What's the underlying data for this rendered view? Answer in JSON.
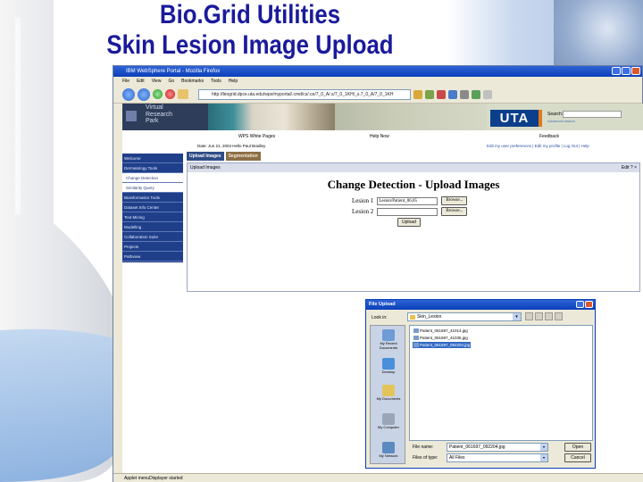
{
  "slide": {
    "title_line1": "Bio.Grid Utilities",
    "title_line2": "Skin Lesion Image Upload"
  },
  "browser": {
    "window_title": "IBM WebSphere Portal - Mozilla Firefox",
    "menu": [
      "File",
      "Edit",
      "View",
      "Go",
      "Bookmarks",
      "Tools",
      "Help"
    ],
    "address": "http://biogrid.dpce.uta.edu/wps/myportal/.cmd/cs/.ce/7_0_A/.s/7_0_1KH/_s.7_0_A/7_0_1KH",
    "status": "Applet menuDisplayer started"
  },
  "portal": {
    "vrp_line1": "Virtual",
    "vrp_line2": "Research",
    "vrp_line3": "Park",
    "uta_logo": "UTA",
    "search_label": "Search:",
    "search_sub": "Advanced search",
    "wp_link": "WPS White Pages",
    "help_link": "Help Now",
    "feedback_link": "Feedback",
    "user_line": "Date: Jun 21, 2004   Hello Paul Bradley",
    "right_links": "Edit my user preferences  |  Edit my profile  |  Log Out  |  Help",
    "tabs": [
      "Upload Images",
      "Segmentation"
    ],
    "nav": [
      "Welcome",
      "Dermatology Tools",
      "Change Detection",
      "Similarity Query",
      "Bioinformatics Tools",
      "Dataset Info Center",
      "Text Mining",
      "Modelling",
      "Collaboration Suite",
      "Projects",
      "Pathview"
    ],
    "portlet_head": "Upload Images",
    "portlet_ctl": "Edit  ?  ×",
    "cd_title": "Change Detection - Upload Images",
    "lesion1_label": "Lesion 1",
    "lesion1_value": "Lesion/Patient_06,05",
    "lesion2_label": "Lesion 2",
    "lesion2_value": "",
    "browse_label": "Browse...",
    "upload_label": "Upload"
  },
  "dialog": {
    "title": "File Upload",
    "lookin_label": "Look in:",
    "lookin_value": "Skin_Lesion",
    "places": [
      "My Recent Documents",
      "Desktop",
      "My Documents",
      "My Computer",
      "My Network"
    ],
    "files": [
      "Patient_061697_41014.jpg",
      "Patient_061697_41035.jpg",
      "Patient_061697_092204.jpg"
    ],
    "selected_index": 2,
    "fname_label": "File name:",
    "fname_value": "Patient_061697_092204.jpg",
    "ftype_label": "Files of type:",
    "ftype_value": "All Files",
    "open_label": "Open",
    "cancel_label": "Cancel"
  }
}
